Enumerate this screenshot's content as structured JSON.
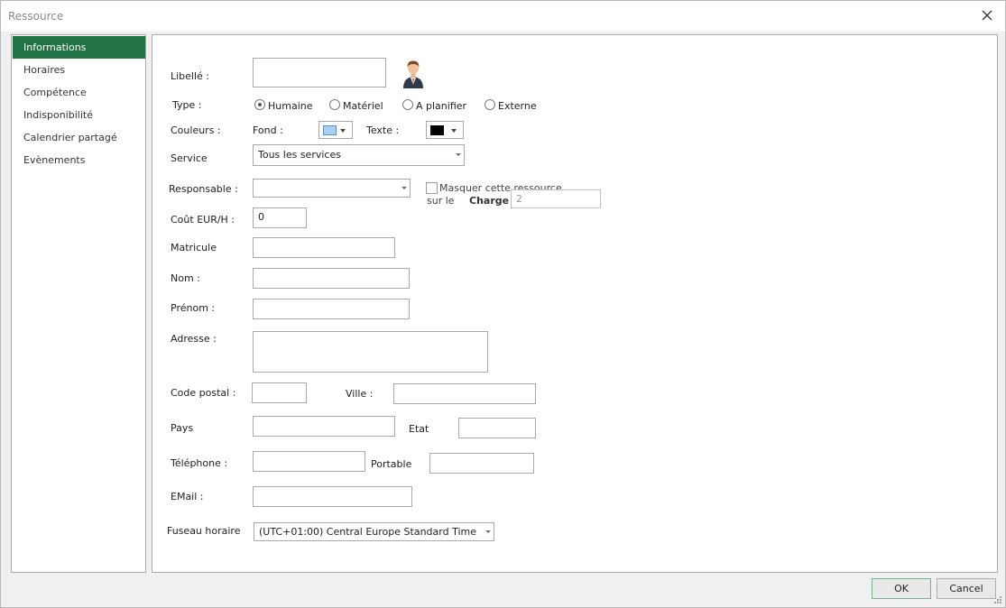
{
  "window": {
    "title": "Ressource"
  },
  "sidebar": {
    "items": [
      {
        "label": "Informations",
        "active": true
      },
      {
        "label": "Horaires"
      },
      {
        "label": "Compétence"
      },
      {
        "label": "Indisponibilité"
      },
      {
        "label": "Calendrier partagé"
      },
      {
        "label": "Evènements"
      }
    ]
  },
  "form": {
    "libelle_label": "Libellé :",
    "libelle_value": "",
    "avatar_icon": "user-avatar-icon",
    "type_label": "Type :",
    "type_options": [
      "Humaine",
      "Matériel",
      "A planifier",
      "Externe"
    ],
    "type_selected": "Humaine",
    "couleurs_label": "Couleurs :",
    "fond_label": "Fond :",
    "fond_color": "#a9cff2",
    "texte_label": "Texte :",
    "texte_color": "#000000",
    "service_label": "Service",
    "service_value": "Tous les services",
    "responsable_label": "Responsable :",
    "responsable_value": "",
    "masquer_label": "Masquer cette ressource",
    "masquer_sub_label": "sur le ",
    "charge_label": "Charge",
    "charge_value": "2",
    "cout_label": "Coût EUR/H :",
    "cout_value": "0",
    "matricule_label": "Matricule",
    "matricule_value": "",
    "nom_label": "Nom :",
    "nom_value": "",
    "prenom_label": "Prénom :",
    "prenom_value": "",
    "adresse_label": "Adresse :",
    "adresse_value": "",
    "code_postal_label": "Code postal :",
    "code_postal_value": "",
    "ville_label": "Ville :",
    "ville_value": "",
    "pays_label": "Pays",
    "pays_value": "",
    "etat_label": "Etat",
    "etat_value": "",
    "telephone_label": "Téléphone :",
    "telephone_value": "",
    "portable_label": "Portable",
    "portable_value": "",
    "email_label": "EMail :",
    "email_value": "",
    "fuseau_label": "Fuseau horaire",
    "fuseau_value": "(UTC+01:00) Central Europe Standard Time"
  },
  "buttons": {
    "ok": "OK",
    "cancel": "Cancel"
  },
  "colors": {
    "accent": "#217346"
  }
}
